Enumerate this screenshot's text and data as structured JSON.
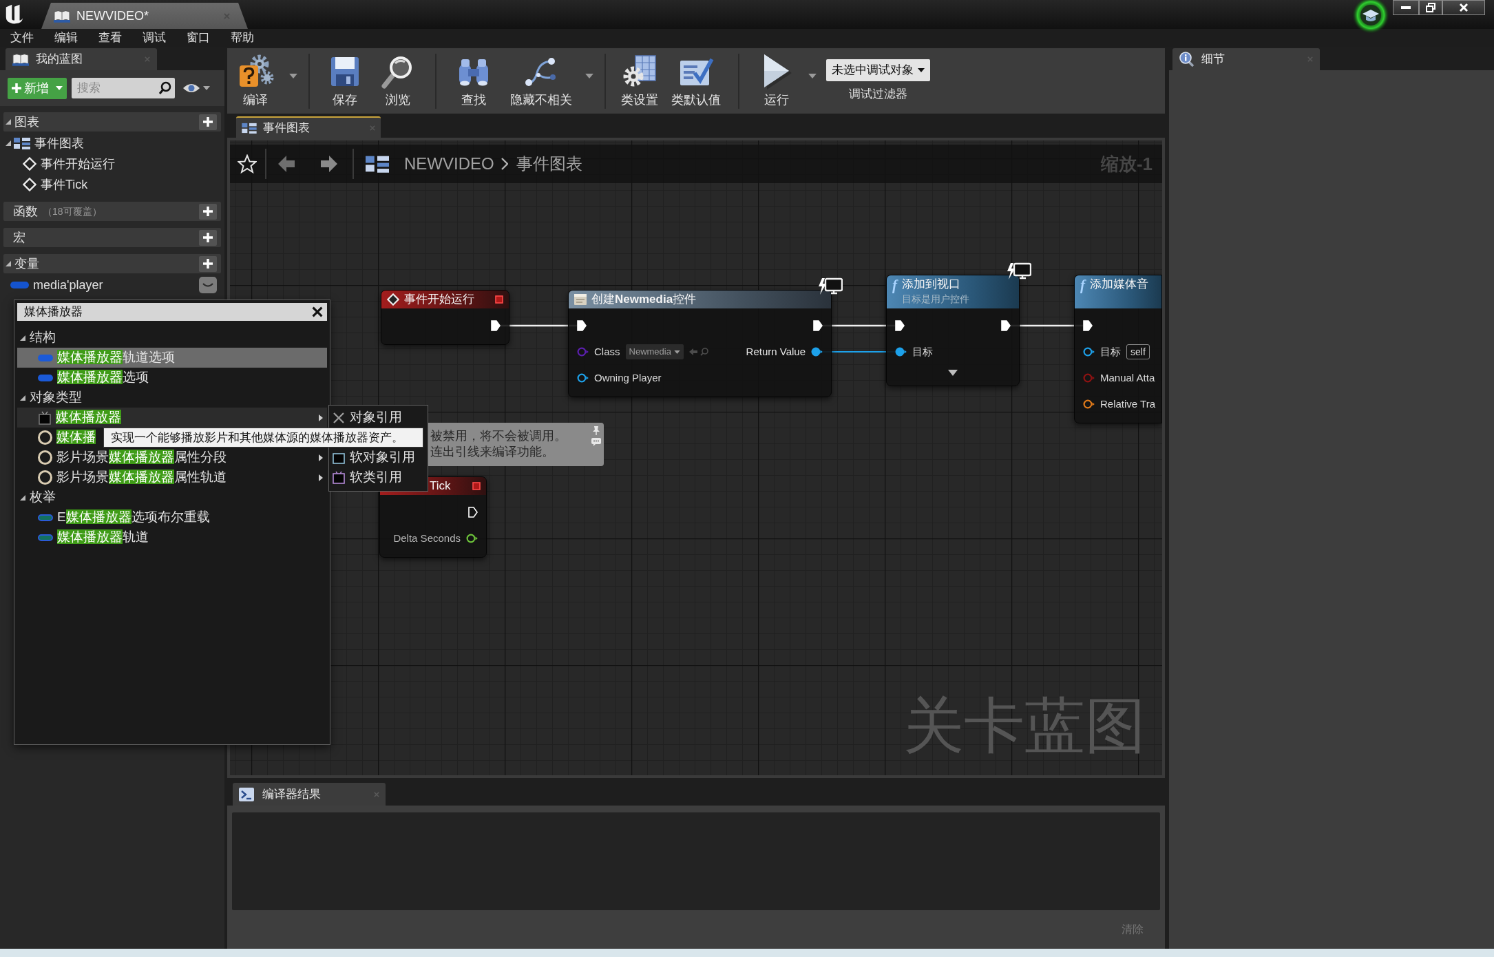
{
  "title_bar": {
    "tabs": [
      {
        "label": "NEWVIDEO*",
        "selected": true
      }
    ]
  },
  "menu_bar": [
    "文件",
    "编辑",
    "查看",
    "调试",
    "窗口",
    "帮助"
  ],
  "my_blueprint": {
    "tab": "我的蓝图",
    "add_button": "新增",
    "search": {
      "placeholder": "搜索"
    },
    "sections": [
      {
        "label": "图表",
        "expanded": true,
        "items": [
          {
            "kind": "graph",
            "label": "事件图表",
            "expanded": true,
            "children": [
              {
                "kind": "event",
                "label": "事件开始运行"
              },
              {
                "kind": "event",
                "label": "事件Tick"
              }
            ]
          }
        ]
      },
      {
        "label": "函数",
        "note": "（18可覆盖）"
      },
      {
        "label": "宏"
      },
      {
        "label": "变量",
        "expanded": true,
        "items": [
          {
            "kind": "variable",
            "label": "media'player"
          }
        ]
      }
    ]
  },
  "toolbar": {
    "groups": [
      [
        {
          "kind": "compile",
          "label": "编译",
          "has_menu": true
        }
      ],
      [
        {
          "kind": "save",
          "label": "保存",
          "has_menu": false
        },
        {
          "kind": "browse",
          "label": "浏览",
          "has_menu": false
        }
      ],
      [
        {
          "kind": "find",
          "label": "查找",
          "has_menu": false
        },
        {
          "kind": "hide_unrelated",
          "label": "隐藏不相关",
          "has_menu": true
        }
      ],
      [
        {
          "kind": "class_settings",
          "label": "类设置",
          "has_menu": false
        },
        {
          "kind": "class_defaults",
          "label": "类默认值",
          "has_menu": false
        }
      ],
      [
        {
          "kind": "play",
          "label": "运行",
          "has_menu": true
        }
      ]
    ],
    "debug_filter": {
      "value": "未选中调试对象",
      "label": "调试过滤器"
    }
  },
  "graph_tabs": [
    {
      "label": "事件图表",
      "selected": true
    }
  ],
  "graph": {
    "breadcrumb": [
      "NEWVIDEO",
      "事件图表"
    ],
    "zoom": "缩放-1",
    "graph_type": "关卡蓝图",
    "nodes": [
      {
        "kind": "event",
        "title": "事件开始运行",
        "monitor_badge": false,
        "has_advanced": false,
        "outputs": [
          {
            "kind": "exec",
            "connected": true
          }
        ]
      },
      {
        "kind": "create_widget",
        "title": "创建**Newmedia**控件",
        "monitor_badge": true,
        "has_advanced": false,
        "inputs": [
          {
            "kind": "exec",
            "connected": true
          },
          {
            "kind": "class",
            "label": "Class",
            "value": "Newmedia",
            "connected": false
          },
          {
            "kind": "object",
            "label": "Owning Player",
            "connected": false
          }
        ],
        "outputs": [
          {
            "kind": "exec",
            "connected": true
          },
          {
            "kind": "object",
            "label": "Return Value",
            "connected": true
          }
        ]
      },
      {
        "kind": "function",
        "glyph": "f",
        "title": "添加到视口",
        "subtitle": "目标是用户控件",
        "monitor_badge": true,
        "has_advanced": true,
        "inputs": [
          {
            "kind": "exec",
            "connected": true
          },
          {
            "kind": "object",
            "label": "目标",
            "connected": true
          }
        ],
        "outputs": [
          {
            "kind": "exec",
            "connected": true
          }
        ]
      },
      {
        "kind": "function",
        "glyph": "f",
        "title": "添加媒体音",
        "monitor_badge": false,
        "has_advanced": false,
        "inputs": [
          {
            "kind": "exec",
            "connected": true
          },
          {
            "kind": "object",
            "label": "目标",
            "value": "self",
            "connected": false
          },
          {
            "kind": "bool",
            "label": "Manual Atta",
            "connected": false
          },
          {
            "kind": "transform",
            "label": "Relative Tra",
            "connected": false
          }
        ]
      },
      {
        "kind": "event",
        "title": "Tick",
        "monitor_badge": false,
        "has_advanced": false,
        "outputs": [
          {
            "kind": "exec",
            "connected": false
          },
          {
            "kind": "float",
            "label": "Delta Seconds",
            "connected": false
          }
        ]
      }
    ],
    "comment": {
      "lines": [
        "被禁用，将不会被调用。",
        "连出引线来编译功能。"
      ]
    }
  },
  "type_picker": {
    "search": {
      "value": "媒体播放器"
    },
    "categories": [
      {
        "label": "结构",
        "expanded": true,
        "items": [
          {
            "kind": "struct",
            "match": "媒体播放器",
            "suffix": "轨道选项",
            "selected": true,
            "hovered": false,
            "has_submenu": false
          },
          {
            "kind": "struct",
            "match": "媒体播放器",
            "suffix": "选项",
            "selected": false,
            "hovered": false,
            "has_submenu": false
          }
        ]
      },
      {
        "label": "对象类型",
        "expanded": true,
        "items": [
          {
            "kind": "object",
            "match": "媒体播放器",
            "selected": false,
            "hovered": true,
            "has_submenu": true
          },
          {
            "kind": "class",
            "match": "媒体播",
            "selected": false,
            "hovered": false,
            "has_submenu": false
          },
          {
            "kind": "class",
            "prefix": "影片场景",
            "match": "媒体播放器",
            "suffix": "属性分段",
            "selected": false,
            "hovered": false,
            "has_submenu": true
          },
          {
            "kind": "class",
            "prefix": "影片场景",
            "match": "媒体播放器",
            "suffix": "属性轨道",
            "selected": false,
            "hovered": false,
            "has_submenu": true
          }
        ]
      },
      {
        "label": "枚举",
        "expanded": true,
        "items": [
          {
            "kind": "enum",
            "prefix": "E",
            "match": "媒体播放器",
            "suffix": "选项布尔重载",
            "selected": false,
            "hovered": false,
            "has_submenu": false
          },
          {
            "kind": "enum",
            "match": "媒体播放器",
            "suffix": "轨道",
            "selected": false,
            "hovered": false,
            "has_submenu": false
          }
        ]
      }
    ],
    "submenu": [
      {
        "kind": "object_ref",
        "label": "对象引用"
      },
      {
        "kind": "soft_object_ref",
        "label": "软对象引用"
      },
      {
        "kind": "soft_class_ref",
        "label": "软类引用"
      }
    ],
    "tooltip": "实现一个能够播放影片和其他媒体源的媒体播放器资产。"
  },
  "details_panel": {
    "tab": "细节"
  },
  "compiler_results": {
    "tab": "编译器结果",
    "clear_button": {
      "label": "清除",
      "disabled": true
    }
  }
}
